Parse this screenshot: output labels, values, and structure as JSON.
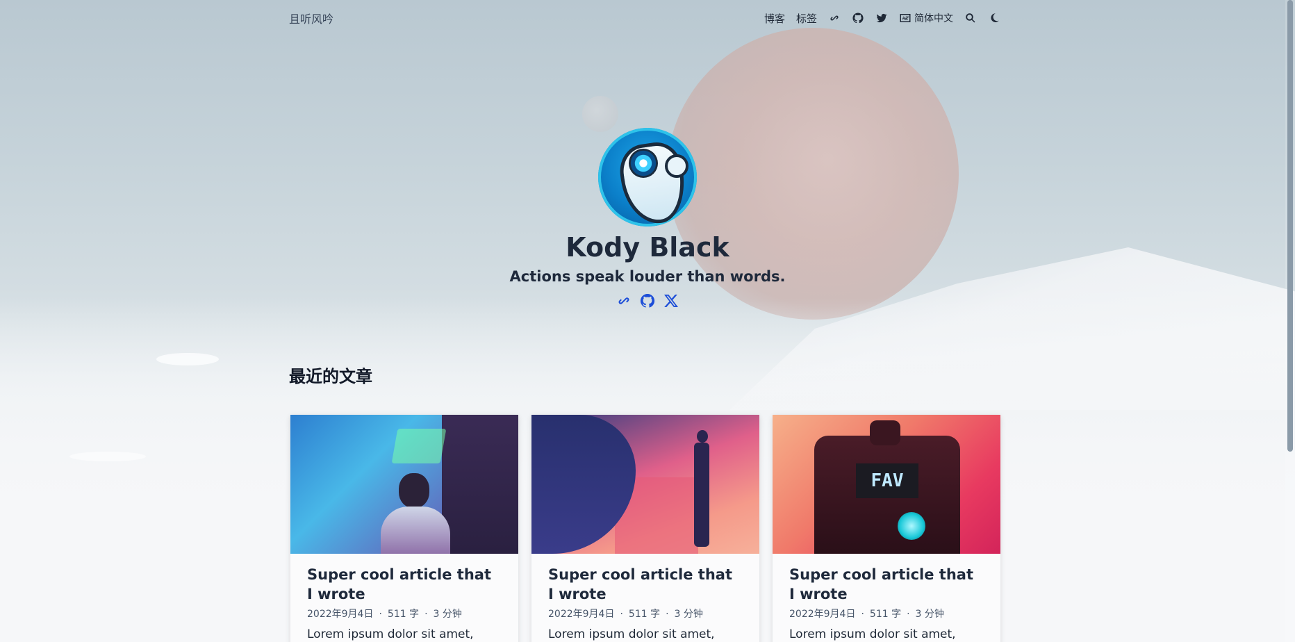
{
  "header": {
    "brand": "且听风吟",
    "nav": {
      "blog": "博客",
      "tags": "标签",
      "language": "简体中文"
    },
    "icons": [
      "link-icon",
      "github-icon",
      "twitter-icon",
      "language-icon",
      "search-icon",
      "moon-icon"
    ]
  },
  "hero": {
    "name": "Kody Black",
    "tagline": "Actions speak louder than words.",
    "social_icons": [
      "link-icon",
      "github-icon",
      "x-icon"
    ]
  },
  "section": {
    "title": "最近的文章"
  },
  "posts": [
    {
      "title": "Super cool article that I wrote",
      "date": "2022年9月4日",
      "words": "511 字",
      "read_time": "3 分钟",
      "summary": "Lorem ipsum dolor sit amet,"
    },
    {
      "title": "Super cool article that I wrote",
      "date": "2022年9月4日",
      "words": "511 字",
      "read_time": "3 分钟",
      "summary": "Lorem ipsum dolor sit amet,"
    },
    {
      "title": "Super cool article that I wrote",
      "date": "2022年9月4日",
      "words": "511 字",
      "read_time": "3 分钟",
      "summary": "Lorem ipsum dolor sit amet,"
    }
  ],
  "thumb_text": "FAV",
  "meta_separator": "·",
  "colors": {
    "accent": "#1d4ed8",
    "text": "#1e293b"
  }
}
